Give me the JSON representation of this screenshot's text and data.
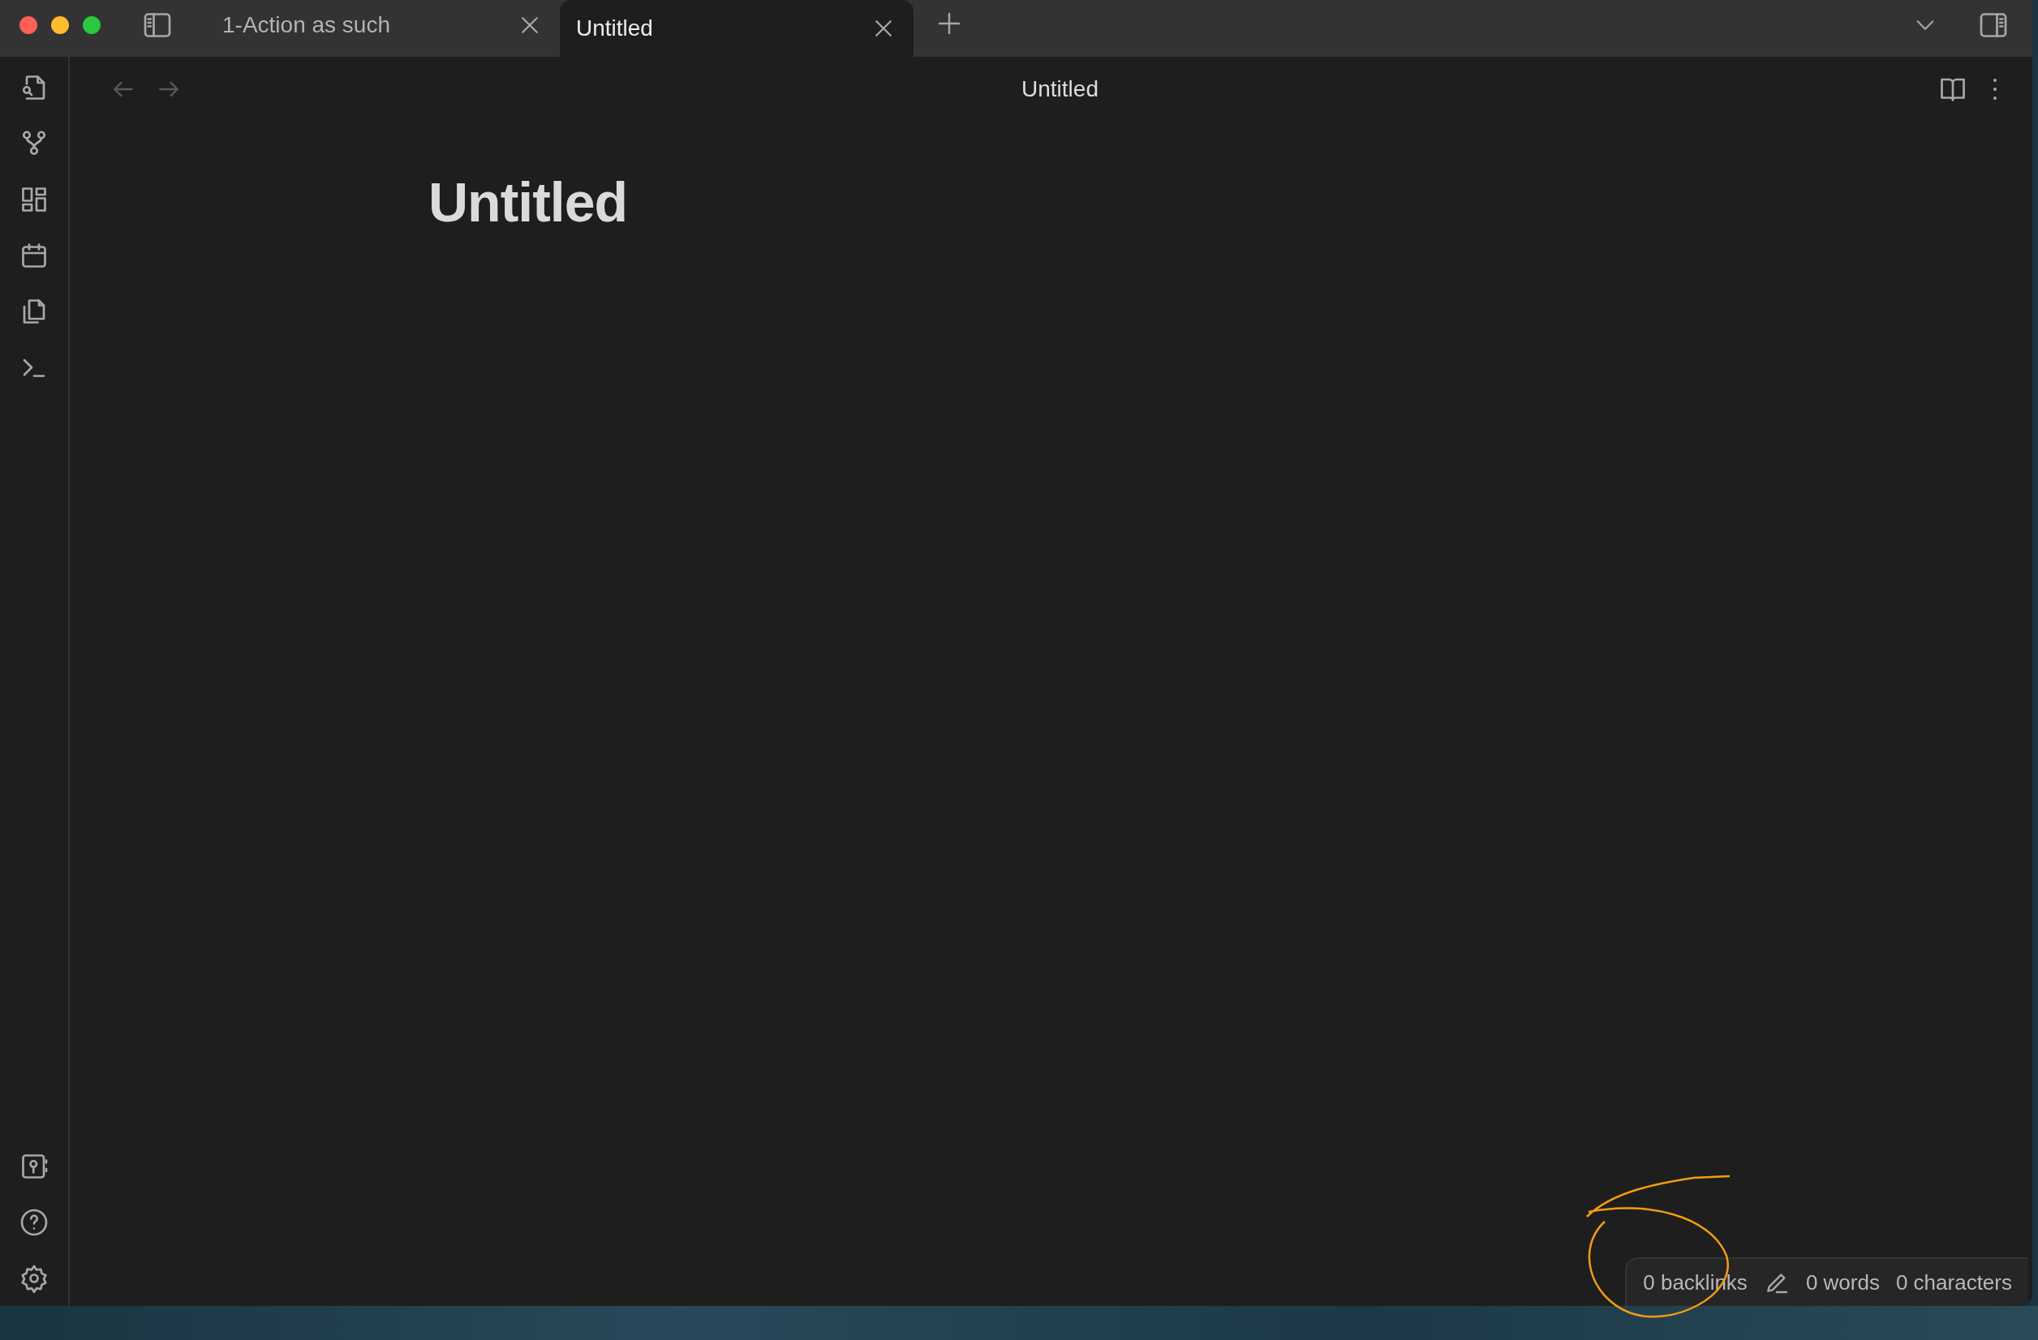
{
  "tabs": [
    {
      "label": "1-Action as such",
      "selected": false
    },
    {
      "label": "Untitled",
      "selected": true
    }
  ],
  "view_header": {
    "title": "Untitled"
  },
  "note": {
    "heading": "Untitled"
  },
  "status_bar": {
    "backlinks": "0 backlinks",
    "words": "0 words",
    "characters": "0 characters"
  }
}
